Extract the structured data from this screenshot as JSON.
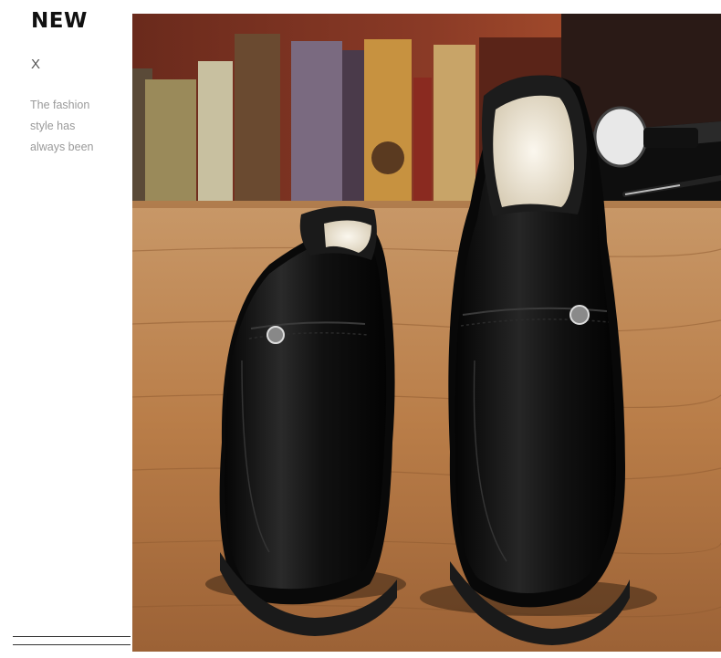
{
  "banner": {
    "title": "NEW",
    "mark": "X",
    "tagline": [
      "The fashion",
      "style has",
      "always been"
    ]
  },
  "photo": {
    "subject": "black leather slip-on shoes with fleece lining on a wooden table",
    "colors": {
      "wood": "#c48a52",
      "leather": "#0c0c0c",
      "fleece": "#efe8d8"
    }
  }
}
